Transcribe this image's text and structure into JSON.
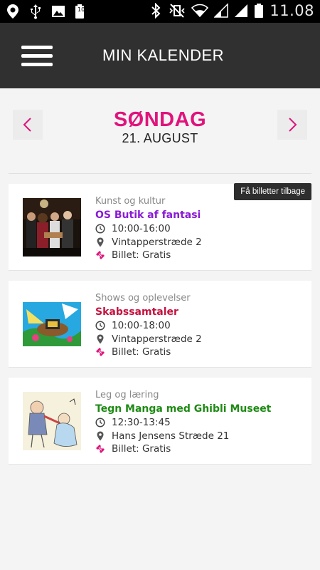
{
  "status_bar": {
    "time": "11.08",
    "battery_level": "100",
    "left_icons": [
      "location-icon",
      "usb-icon",
      "image-icon",
      "battery-saver-icon"
    ],
    "right_icons": [
      "bluetooth-icon",
      "vibrate-mute-icon",
      "wifi-icon",
      "signal-icon",
      "signal-icon",
      "battery-icon"
    ]
  },
  "app_bar": {
    "title": "MIN KALENDER",
    "menu_icon": "hamburger-menu-icon"
  },
  "date_header": {
    "day": "SØNDAG",
    "date": "21. AUGUST",
    "prev_icon": "chevron-left-icon",
    "next_icon": "chevron-right-icon"
  },
  "colors": {
    "accent": "#e0137c",
    "appbar": "#303030",
    "background": "#f4f4f4"
  },
  "events": [
    {
      "category": "Kunst og kultur",
      "title": "OS Butik af fantasi",
      "title_color": "#8a1bd6",
      "time": "10:00-16:00",
      "location": "Vintapperstræde 2",
      "ticket": "Billet: Gratis",
      "badge": "Få billetter tilbage"
    },
    {
      "category": "Shows og oplevelser",
      "title": "Skabssamtaler",
      "title_color": "#c4123f",
      "time": "10:00-18:00",
      "location": "Vintapperstræde 2",
      "ticket": "Billet: Gratis"
    },
    {
      "category": "Leg og læring",
      "title": "Tegn Manga med Ghibli Museet",
      "title_color": "#1e8a14",
      "time": "12:30-13:45",
      "location": "Hans Jensens Stræde 21",
      "ticket": "Billet: Gratis"
    }
  ]
}
